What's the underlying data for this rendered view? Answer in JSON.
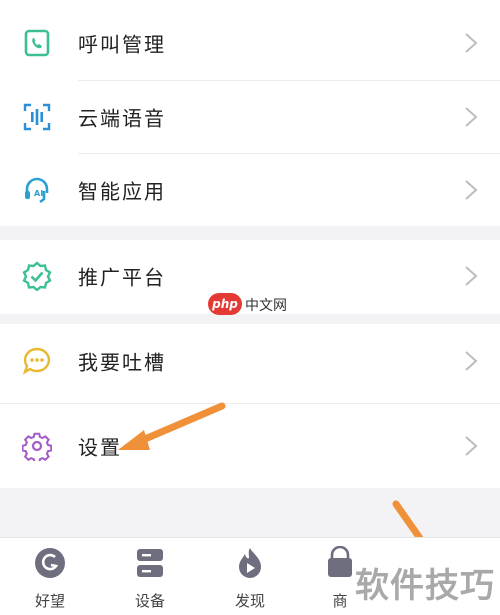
{
  "menu": {
    "group1": [
      {
        "label": "呼叫管理",
        "icon": "phone-card-icon",
        "color": "#3cc090"
      },
      {
        "label": "云端语音",
        "icon": "sound-wave-icon",
        "color": "#2b8fd8"
      },
      {
        "label": "智能应用",
        "icon": "ai-headset-icon",
        "color": "#2a9fd6"
      }
    ],
    "group2": [
      {
        "label": "推广平台",
        "icon": "badge-check-icon",
        "color": "#3cc090"
      }
    ],
    "group3": [
      {
        "label": "我要吐槽",
        "icon": "chat-bubble-icon",
        "color": "#e8b930"
      },
      {
        "label": "设置",
        "icon": "gear-icon",
        "color": "#a45bc8"
      }
    ]
  },
  "tabbar": [
    {
      "label": "好望",
      "icon": "haowang-logo-icon"
    },
    {
      "label": "设备",
      "icon": "device-icon"
    },
    {
      "label": "发现",
      "icon": "flame-play-icon"
    },
    {
      "label": "商",
      "icon": "shop-bag-icon"
    }
  ],
  "watermark": {
    "text": "软件技巧"
  },
  "logo": {
    "php": "php",
    "site": "中文网"
  },
  "colors": {
    "arrow": "#f0913a",
    "chevron": "#bdbdbd",
    "background": "#f3f3f5"
  }
}
